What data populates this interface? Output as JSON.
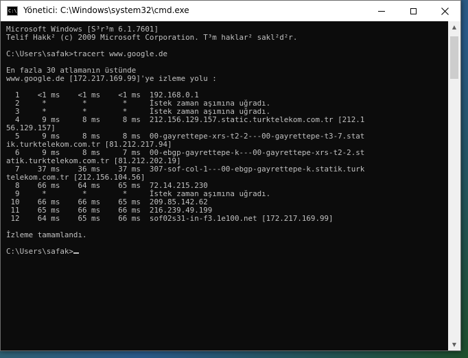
{
  "window": {
    "title": "Yönetici: C:\\Windows\\system32\\cmd.exe",
    "app_icon_text": "C:\\"
  },
  "controls": {
    "minimize": "minimize-icon",
    "maximize": "maximize-icon",
    "close": "close-icon"
  },
  "console": {
    "lines": [
      "Microsoft Windows [S³r³m 6.1.7601]",
      "Telif Hakk² (c) 2009 Microsoft Corporation. T³m haklar² sakl²d²r.",
      "",
      "C:\\Users\\safak>tracert www.google.de",
      "",
      "En fazla 30 atlamanın üstünde",
      "www.google.de [172.217.169.99]'ye izleme yolu :",
      "",
      "  1    <1 ms    <1 ms    <1 ms  192.168.0.1",
      "  2     *        *        *     İstek zaman aşımına uğradı.",
      "  3     *        *        *     İstek zaman aşımına uğradı.",
      "  4     9 ms     8 ms     8 ms  212.156.129.157.static.turktelekom.com.tr [212.1",
      "56.129.157]",
      "  5     9 ms     8 ms     8 ms  00-gayrettepe-xrs-t2-2---00-gayrettepe-t3-7.stat",
      "ik.turktelekom.com.tr [81.212.217.94]",
      "  6     9 ms     8 ms     7 ms  00-ebgp-gayrettepe-k---00-gayrettepe-xrs-t2-2.st",
      "atik.turktelekom.com.tr [81.212.202.19]",
      "  7    37 ms    36 ms    37 ms  307-sof-col-1---00-ebgp-gayrettepe-k.statik.turk",
      "telekom.com.tr [212.156.104.56]",
      "  8    66 ms    64 ms    65 ms  72.14.215.230",
      "  9     *        *        *     İstek zaman aşımına uğradı.",
      " 10    66 ms    66 ms    65 ms  209.85.142.62",
      " 11    65 ms    66 ms    66 ms  216.239.49.199",
      " 12    64 ms    65 ms    66 ms  sof02s31-in-f3.1e100.net [172.217.169.99]",
      "",
      "İzleme tamamlandı.",
      "",
      "C:\\Users\\safak>"
    ]
  },
  "colors": {
    "console_bg": "#0c0c0c",
    "console_fg": "#c0c0c0"
  },
  "scrollbar": {
    "up_icon": "scroll-up-icon",
    "down_icon": "scroll-down-icon"
  }
}
